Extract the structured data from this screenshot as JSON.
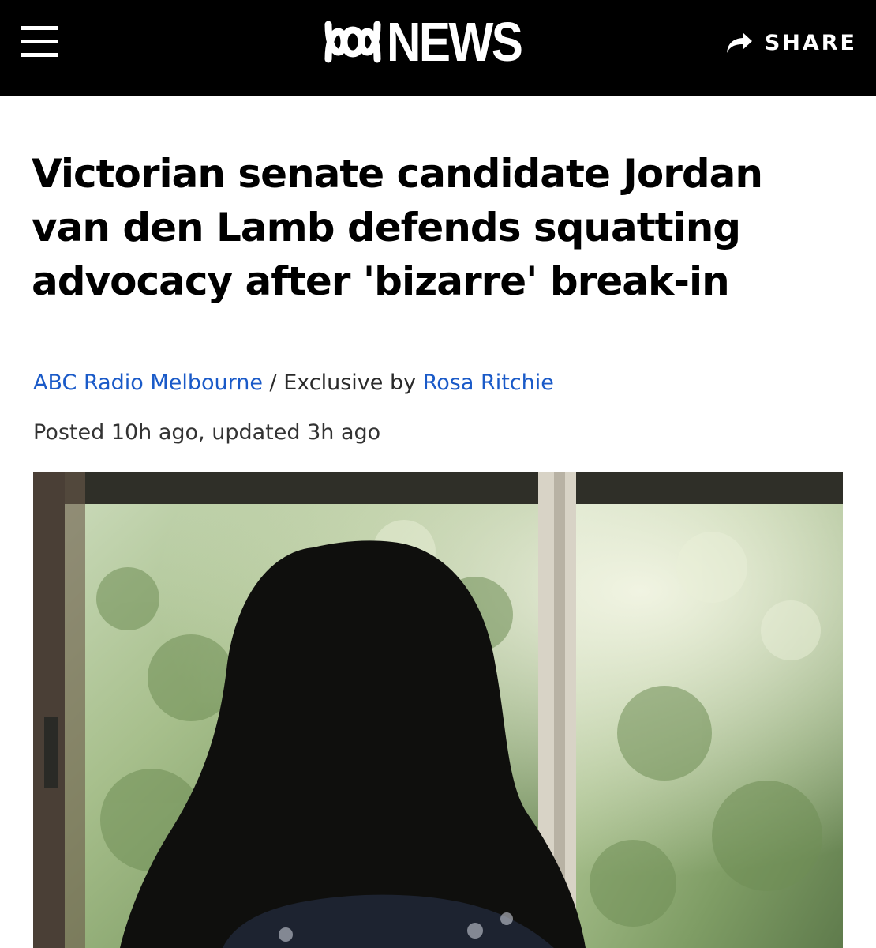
{
  "header": {
    "logo_text": "NEWS",
    "share_label": "SHARE"
  },
  "article": {
    "headline": "Victorian senate candidate Jordan van den Lamb defends squatting advocacy after 'bizarre' break-in",
    "source_link": "ABC Radio Melbourne",
    "byline_middle": "/ Exclusive by",
    "author_link": "Rosa Ritchie",
    "dateline": "Posted 10h ago, updated 3h ago"
  },
  "colors": {
    "header_bg": "#000000",
    "link": "#1a5ac8",
    "text": "#000000"
  }
}
